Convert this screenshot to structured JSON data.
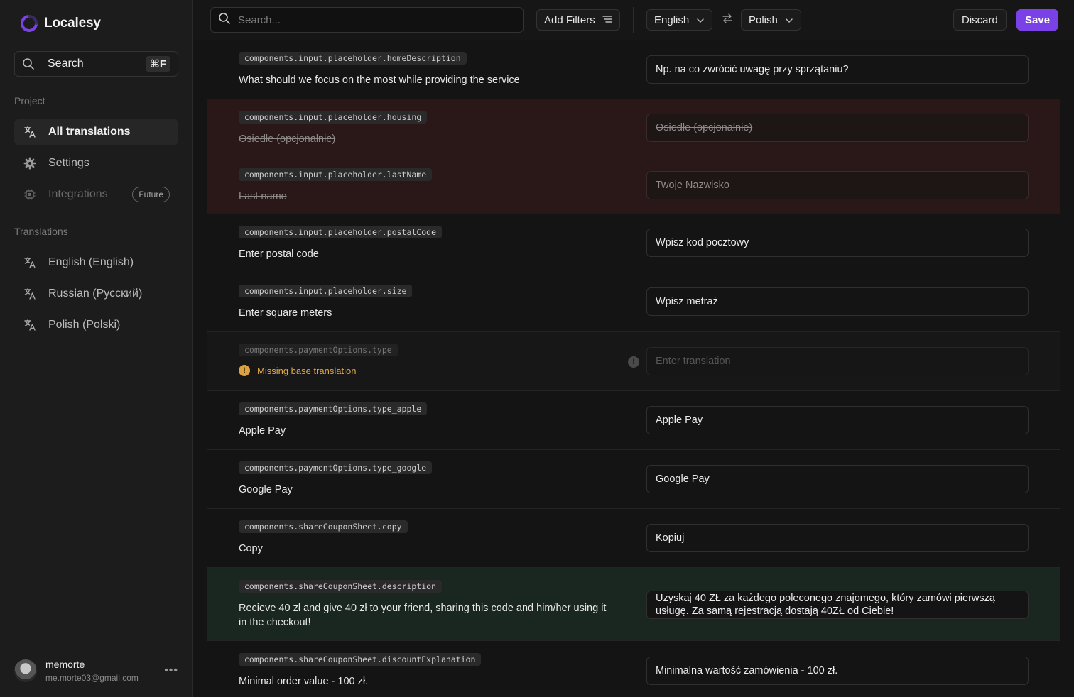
{
  "brand": {
    "name": "Localesy",
    "accent": "#7a42e6"
  },
  "sidebar": {
    "search_label": "Search",
    "search_shortcut": "⌘F",
    "project_label": "Project",
    "project_items": [
      {
        "label": "All translations",
        "icon": "translate-icon",
        "active": true
      },
      {
        "label": "Settings",
        "icon": "gear-icon"
      },
      {
        "label": "Integrations",
        "icon": "chip-icon",
        "badge": "Future",
        "disabled": true
      }
    ],
    "translations_label": "Translations",
    "language_items": [
      {
        "label": "English (English)",
        "icon": "translate-icon"
      },
      {
        "label": "Russian (Русский)",
        "icon": "translate-icon"
      },
      {
        "label": "Polish (Polski)",
        "icon": "translate-icon"
      }
    ],
    "user": {
      "name": "memorte",
      "email": "me.morte03@gmail.com"
    }
  },
  "toolbar": {
    "search_placeholder": "Search...",
    "filters_label": "Add Filters",
    "source_lang": "English",
    "target_lang": "Polish",
    "discard_label": "Discard",
    "save_label": "Save"
  },
  "rows": [
    {
      "key": "components.input.placeholder.homeDescription",
      "source": "What should we focus on the most while providing the service",
      "translation": "Np. na co zwrócić uwagę przy sprzątaniu?"
    },
    {
      "key": "components.input.placeholder.housing",
      "source": "Osiedle (opcjonalnie)",
      "translation": "Osiedle (opcjonalnie)",
      "state": "deleted"
    },
    {
      "key": "components.input.placeholder.lastName",
      "source": "Last name",
      "translation": "Twoje Nazwisko",
      "state": "deleted"
    },
    {
      "key": "components.input.placeholder.postalCode",
      "source": "Enter postal code",
      "translation": "Wpisz kod pocztowy"
    },
    {
      "key": "components.input.placeholder.size",
      "source": "Enter square meters",
      "translation": "Wpisz metraż"
    },
    {
      "key": "components.paymentOptions.type",
      "warning": "Missing base translation",
      "placeholder": "Enter translation",
      "state": "missing"
    },
    {
      "key": "components.paymentOptions.type_apple",
      "source": "Apple Pay",
      "translation": "Apple Pay"
    },
    {
      "key": "components.paymentOptions.type_google",
      "source": "Google Pay",
      "translation": "Google Pay"
    },
    {
      "key": "components.shareCouponSheet.copy",
      "source": "Copy",
      "translation": "Kopiuj"
    },
    {
      "key": "components.shareCouponSheet.description",
      "source": "Recieve 40 zł and give 40 zł to your friend, sharing this code and him/her using it in the checkout!",
      "translation": "Uzyskaj 40 ZŁ za każdego poleconego znajomego, który zamówi pierwszą usługę. Za samą rejestracją dostają 40ZŁ od Ciebie!",
      "state": "changed"
    },
    {
      "key": "components.shareCouponSheet.discountExplanation",
      "source": "Minimal order value - 100 zł.",
      "translation": "Minimalna wartość zamówienia - 100 zł."
    }
  ]
}
